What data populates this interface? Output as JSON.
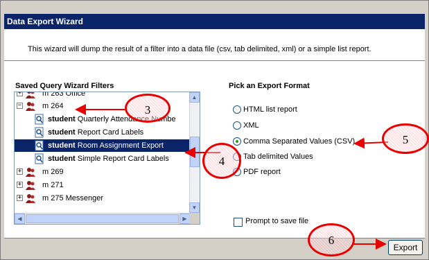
{
  "window": {
    "title": "Data Export Wizard"
  },
  "intro": {
    "text": "This wizard will dump the result of a filter into a data file (csv, tab delimited, xml) or a simple list report."
  },
  "filters": {
    "heading": "Saved Query Wizard Filters",
    "rows": [
      {
        "kind": "folder",
        "expander": "+",
        "label": "m 263 Office"
      },
      {
        "kind": "folder",
        "expander": "−",
        "label": "m 264"
      },
      {
        "kind": "query",
        "bold": "student",
        "label": "Quarterly Attendance Numbe"
      },
      {
        "kind": "query",
        "bold": "student",
        "label": "Report Card Labels"
      },
      {
        "kind": "query",
        "bold": "student",
        "label": "Room Assignment Export",
        "selected": true
      },
      {
        "kind": "query",
        "bold": "student",
        "label": "Simple Report Card Labels"
      },
      {
        "kind": "folder",
        "expander": "+",
        "label": "m 269"
      },
      {
        "kind": "folder",
        "expander": "+",
        "label": "m 271"
      },
      {
        "kind": "folder",
        "expander": "+",
        "label": "m 275 Messenger"
      }
    ],
    "scroll": {
      "up": "▲",
      "down": "▼",
      "left": "◀",
      "right": "▶"
    }
  },
  "format": {
    "heading": "Pick an Export Format",
    "options": [
      {
        "label": "HTML list report",
        "selected": false
      },
      {
        "label": "XML",
        "selected": false
      },
      {
        "label": "Comma Separated Values (CSV)",
        "selected": true
      },
      {
        "label": "Tab delimited Values",
        "selected": false
      },
      {
        "label": "PDF report",
        "selected": false
      }
    ],
    "prompt_label": "Prompt to save file",
    "prompt_checked": false
  },
  "footer": {
    "export_label": "Export"
  },
  "callouts": [
    {
      "number": "3"
    },
    {
      "number": "4"
    },
    {
      "number": "5"
    },
    {
      "number": "6"
    }
  ],
  "colors": {
    "title_bar": "#0a246a",
    "selection": "#0a246a",
    "callout_border": "#e80000",
    "arrow": "#e80000"
  }
}
